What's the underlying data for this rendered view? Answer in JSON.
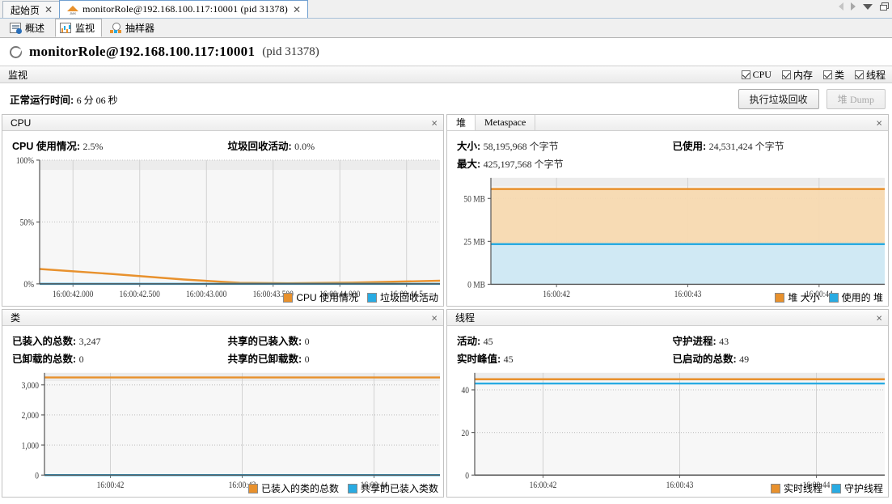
{
  "window": {
    "tabs": [
      {
        "label": "起始页",
        "icon": "none",
        "active": false,
        "closable": true
      },
      {
        "label": "monitorRole@192.168.100.117:10001 (pid 31378)",
        "icon": "jmx-icon",
        "active": true,
        "closable": true
      }
    ],
    "controls": [
      "scroll-left-arrow",
      "scroll-right-arrow",
      "tab-list-chevron",
      "restore-window-icon"
    ]
  },
  "subtabs": [
    {
      "label": "概述",
      "icon": "overview-icon",
      "active": false
    },
    {
      "label": "监视",
      "icon": "monitor-icon",
      "active": true
    },
    {
      "label": "抽样器",
      "icon": "sampler-icon",
      "active": false
    }
  ],
  "connection": {
    "title": "monitorRole@192.168.100.117:10001",
    "pid": "(pid 31378)",
    "icon": "connection-circle-icon"
  },
  "section": {
    "title": "监视",
    "checkboxes": [
      {
        "label": "CPU",
        "checked": true,
        "mono": true
      },
      {
        "label": "内存",
        "checked": true,
        "mono": false
      },
      {
        "label": "类",
        "checked": true,
        "mono": false
      },
      {
        "label": "线程",
        "checked": true,
        "mono": false
      }
    ]
  },
  "uptime": {
    "label": "正常运行时间:",
    "value": "6 分 06 秒"
  },
  "buttons": {
    "gc": {
      "label": "执行垃圾回收",
      "disabled": false
    },
    "heapdump": {
      "label_cn": "堆",
      "label_en": "Dump",
      "disabled": true
    }
  },
  "panels": {
    "cpu": {
      "title": "CPU",
      "close": "×",
      "stats": [
        {
          "label": "CPU 使用情况:",
          "value": "2.5%"
        },
        {
          "label": "垃圾回收活动:",
          "value": "0.0%"
        }
      ]
    },
    "heap": {
      "tabs": [
        {
          "label": "堆",
          "active": true,
          "mono": false
        },
        {
          "label": "Metaspace",
          "active": false,
          "mono": true
        }
      ],
      "close": "×",
      "stats": [
        {
          "label": "大小:",
          "value": "58,195,968 个字节"
        },
        {
          "label": "已使用:",
          "value": "24,531,424 个字节"
        },
        {
          "label": "最大:",
          "value": "425,197,568 个字节"
        },
        {
          "label": "",
          "value": ""
        }
      ]
    },
    "classes": {
      "title": "类",
      "close": "×",
      "stats": [
        {
          "label": "已装入的总数:",
          "value": "3,247"
        },
        {
          "label": "共享的已装入数:",
          "value": "0"
        },
        {
          "label": "已卸载的总数:",
          "value": "0"
        },
        {
          "label": "共享的已卸载数:",
          "value": "0"
        }
      ]
    },
    "threads": {
      "title": "线程",
      "close": "×",
      "stats": [
        {
          "label": "活动:",
          "value": "45"
        },
        {
          "label": "守护进程:",
          "value": "43"
        },
        {
          "label": "实时峰值:",
          "value": "45"
        },
        {
          "label": "已启动的总数:",
          "value": "49"
        }
      ]
    }
  },
  "colors": {
    "orange": "#e8912d",
    "blue": "#29abe2",
    "orange_fill": "#f7d9b0",
    "blue_fill": "#cdeaf8",
    "plot_bg": "#f7f7f7",
    "plot_bg_top": "#ececec",
    "grid": "#c8c8c8",
    "axis": "#666666"
  },
  "chart_data": [
    {
      "id": "cpu",
      "type": "line",
      "title": "CPU",
      "xlabel": "",
      "ylabel": "",
      "ylim": [
        0,
        100
      ],
      "yticks": [
        0,
        50,
        100
      ],
      "ytick_labels": [
        "0%",
        "50%",
        "100%"
      ],
      "x_tick_labels": [
        "16:00:42.000",
        "16:00:42.500",
        "16:00:43.000",
        "16:00:43.500",
        "16:00:44.000",
        "16:00:44.5"
      ],
      "grid": true,
      "legend_position": "bottom-right",
      "series": [
        {
          "name": "CPU 使用情况",
          "color": "#e8912d",
          "x": [
            0,
            0.18,
            0.36,
            0.5,
            0.62,
            0.78,
            1.0
          ],
          "values": [
            12.0,
            8.0,
            3.5,
            0.8,
            0.5,
            1.0,
            2.5
          ]
        },
        {
          "name": "垃圾回收活动",
          "color": "#29abe2",
          "x": [
            0,
            0.25,
            0.5,
            0.75,
            1.0
          ],
          "values": [
            0.0,
            0.0,
            0.0,
            0.0,
            0.0
          ]
        }
      ]
    },
    {
      "id": "heap",
      "type": "area",
      "title": "堆",
      "xlabel": "",
      "ylabel": "MB",
      "ylim": [
        0,
        62
      ],
      "yticks": [
        0,
        25,
        50
      ],
      "ytick_labels": [
        "0 MB",
        "25 MB",
        "50 MB"
      ],
      "x_tick_labels": [
        "16:00:42",
        "16:00:43",
        "16:00:44"
      ],
      "grid": true,
      "legend_position": "bottom-right",
      "series": [
        {
          "name": "堆 大小",
          "color": "#e8912d",
          "fill": "#f7d9b0",
          "x": [
            0,
            0.25,
            0.5,
            0.75,
            1.0
          ],
          "values": [
            55.5,
            55.5,
            55.5,
            55.5,
            55.5
          ]
        },
        {
          "name": "使用的 堆",
          "color": "#29abe2",
          "fill": "#cdeaf8",
          "x": [
            0,
            0.25,
            0.5,
            0.75,
            1.0
          ],
          "values": [
            23.4,
            23.4,
            23.4,
            23.4,
            23.4
          ]
        }
      ]
    },
    {
      "id": "classes",
      "type": "line",
      "title": "类",
      "xlabel": "",
      "ylabel": "",
      "ylim": [
        0,
        3400
      ],
      "yticks": [
        0,
        1000,
        2000,
        3000
      ],
      "ytick_labels": [
        "0",
        "1,000",
        "2,000",
        "3,000"
      ],
      "x_tick_labels": [
        "16:00:42",
        "16:00:43",
        "16:00:44"
      ],
      "grid": true,
      "legend_position": "bottom-right",
      "series": [
        {
          "name": "已装入的类的总数",
          "color": "#e8912d",
          "x": [
            0,
            0.25,
            0.5,
            0.75,
            1.0
          ],
          "values": [
            3247,
            3247,
            3247,
            3247,
            3247
          ]
        },
        {
          "name": "共享的已装入类数",
          "color": "#29abe2",
          "x": [
            0,
            0.25,
            0.5,
            0.75,
            1.0
          ],
          "values": [
            0,
            0,
            0,
            0,
            0
          ]
        }
      ]
    },
    {
      "id": "threads",
      "type": "line",
      "title": "线程",
      "xlabel": "",
      "ylabel": "",
      "ylim": [
        0,
        48
      ],
      "yticks": [
        0,
        20,
        40
      ],
      "ytick_labels": [
        "0",
        "20",
        "40"
      ],
      "x_tick_labels": [
        "16:00:42",
        "16:00:43",
        "16:00:44"
      ],
      "grid": true,
      "legend_position": "bottom-right",
      "series": [
        {
          "name": "实时线程",
          "color": "#e8912d",
          "x": [
            0,
            0.25,
            0.5,
            0.75,
            1.0
          ],
          "values": [
            45,
            45,
            45,
            45,
            45
          ]
        },
        {
          "name": "守护线程",
          "color": "#29abe2",
          "x": [
            0,
            0.25,
            0.5,
            0.75,
            1.0
          ],
          "values": [
            43,
            43,
            43,
            43,
            43
          ]
        }
      ]
    }
  ]
}
